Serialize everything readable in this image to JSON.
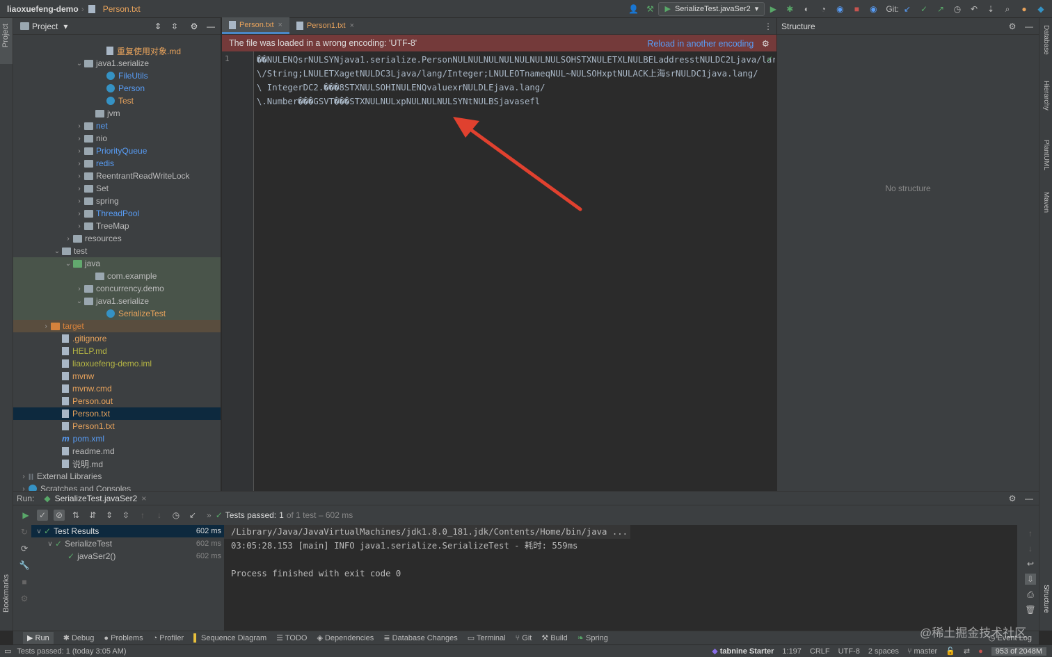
{
  "topbar": {
    "project": "liaoxuefeng-demo",
    "file": "Person.txt",
    "run_config": "SerializeTest.javaSer2",
    "git_label": "Git:"
  },
  "left_strip": {
    "project": "Project",
    "bookmarks": "Bookmarks"
  },
  "right_strip": {
    "database": "Database",
    "hierarchy": "Hierarchy",
    "plantuml": "PlantUML",
    "maven": "Maven",
    "structure": "Structure"
  },
  "project_panel": {
    "title": "Project",
    "items": [
      {
        "label": "重复使用对象.md",
        "indent": 7,
        "kind": "md",
        "color": "#e8a35c",
        "arrow": ""
      },
      {
        "label": "java1.serialize",
        "indent": 5,
        "kind": "folder",
        "color": "#bbbbbb",
        "arrow": "v"
      },
      {
        "label": "FileUtils",
        "indent": 7,
        "kind": "class",
        "color": "#589df6",
        "arrow": ""
      },
      {
        "label": "Person",
        "indent": 7,
        "kind": "class",
        "color": "#589df6",
        "arrow": ""
      },
      {
        "label": "Test",
        "indent": 7,
        "kind": "class",
        "color": "#e8a35c",
        "arrow": ""
      },
      {
        "label": "jvm",
        "indent": 6,
        "kind": "folder",
        "color": "#bbbbbb",
        "arrow": ""
      },
      {
        "label": "net",
        "indent": 5,
        "kind": "folder",
        "color": "#589df6",
        "arrow": ">"
      },
      {
        "label": "nio",
        "indent": 5,
        "kind": "folder",
        "color": "#bbbbbb",
        "arrow": ">"
      },
      {
        "label": "PriorityQueue",
        "indent": 5,
        "kind": "folder",
        "color": "#589df6",
        "arrow": ">"
      },
      {
        "label": "redis",
        "indent": 5,
        "kind": "folder",
        "color": "#589df6",
        "arrow": ">"
      },
      {
        "label": "ReentrantReadWriteLock",
        "indent": 5,
        "kind": "folder",
        "color": "#bbbbbb",
        "arrow": ">"
      },
      {
        "label": "Set",
        "indent": 5,
        "kind": "folder",
        "color": "#bbbbbb",
        "arrow": ">"
      },
      {
        "label": "spring",
        "indent": 5,
        "kind": "folder",
        "color": "#bbbbbb",
        "arrow": ">"
      },
      {
        "label": "ThreadPool",
        "indent": 5,
        "kind": "folder",
        "color": "#589df6",
        "arrow": ">"
      },
      {
        "label": "TreeMap",
        "indent": 5,
        "kind": "folder",
        "color": "#bbbbbb",
        "arrow": ">"
      },
      {
        "label": "resources",
        "indent": 4,
        "kind": "folder",
        "color": "#bbbbbb",
        "arrow": ">"
      },
      {
        "label": "test",
        "indent": 3,
        "kind": "folder",
        "color": "#bbbbbb",
        "arrow": "v"
      },
      {
        "label": "java",
        "indent": 4,
        "kind": "folder-g",
        "color": "#bbbbbb",
        "arrow": "v",
        "bg": "#49544a"
      },
      {
        "label": "com.example",
        "indent": 6,
        "kind": "folder",
        "color": "#bbbbbb",
        "arrow": "",
        "bg": "#49544a"
      },
      {
        "label": "concurrency.demo",
        "indent": 5,
        "kind": "folder",
        "color": "#bbbbbb",
        "arrow": ">",
        "bg": "#49544a"
      },
      {
        "label": "java1.serialize",
        "indent": 5,
        "kind": "folder",
        "color": "#bbbbbb",
        "arrow": "v",
        "bg": "#49544a"
      },
      {
        "label": "SerializeTest",
        "indent": 7,
        "kind": "class",
        "color": "#e8a35c",
        "arrow": "",
        "bg": "#49544a"
      },
      {
        "label": "target",
        "indent": 2,
        "kind": "folder-o",
        "color": "#d6823c",
        "arrow": ">",
        "bg": "#594d3e"
      },
      {
        "label": ".gitignore",
        "indent": 3,
        "kind": "file",
        "color": "#e8a35c",
        "arrow": ""
      },
      {
        "label": "HELP.md",
        "indent": 3,
        "kind": "md",
        "color": "#b5b544",
        "arrow": ""
      },
      {
        "label": "liaoxuefeng-demo.iml",
        "indent": 3,
        "kind": "file",
        "color": "#b5b544",
        "arrow": ""
      },
      {
        "label": "mvnw",
        "indent": 3,
        "kind": "file",
        "color": "#e8a35c",
        "arrow": ""
      },
      {
        "label": "mvnw.cmd",
        "indent": 3,
        "kind": "file",
        "color": "#e8a35c",
        "arrow": ""
      },
      {
        "label": "Person.out",
        "indent": 3,
        "kind": "file",
        "color": "#e8a35c",
        "arrow": ""
      },
      {
        "label": "Person.txt",
        "indent": 3,
        "kind": "file",
        "color": "#e8a35c",
        "arrow": "",
        "bg": "#0d293e"
      },
      {
        "label": "Person1.txt",
        "indent": 3,
        "kind": "file",
        "color": "#e8a35c",
        "arrow": ""
      },
      {
        "label": "pom.xml",
        "indent": 3,
        "kind": "maven",
        "color": "#589df6",
        "arrow": ""
      },
      {
        "label": "readme.md",
        "indent": 3,
        "kind": "md",
        "color": "#bbbbbb",
        "arrow": ""
      },
      {
        "label": "说明.md",
        "indent": 3,
        "kind": "md",
        "color": "#bbbbbb",
        "arrow": ""
      },
      {
        "label": "External Libraries",
        "indent": 0,
        "kind": "lib",
        "color": "#bbbbbb",
        "arrow": ">"
      },
      {
        "label": "Scratches and Consoles",
        "indent": 0,
        "kind": "scratch",
        "color": "#bbbbbb",
        "arrow": ">"
      }
    ]
  },
  "editor": {
    "tabs": [
      {
        "label": "Person.txt",
        "active": true
      },
      {
        "label": "Person1.txt",
        "active": false
      }
    ],
    "warning": "The file was loaded in a wrong encoding: 'UTF-8'",
    "reload_link": "Reload in another encoding",
    "line_number": "1",
    "lines": [
      "��NULENQsrNULSYNjava1.serialize.PersonNULNULNULNULNULNULNULSOHSTXNULETXLNULBELaddresstNULDC2Ljava/lar",
      "\\/String;LNULETXagetNULDC3Ljava/lang/Integer;LNULEOTnameqNUL~NULSOHxptNULACK上海srNULDC1java.lang/",
      "\\ IntegerDC2.���8STXNULSOHINULENQvaluexrNULDLEjava.lang/",
      "\\.Number���GSVT���STXNULNULxpNULNULNULSYNtNULBSjavasefl"
    ]
  },
  "structure": {
    "title": "Structure",
    "empty": "No structure"
  },
  "run": {
    "label": "Run:",
    "tab": "SerializeTest.javaSer2",
    "status_prefix": "Tests passed:",
    "status_count": "1",
    "status_rest": "of 1 test – 602 ms",
    "tree": [
      {
        "label": "Test Results",
        "time": "602 ms"
      },
      {
        "label": "SerializeTest",
        "time": "602 ms"
      },
      {
        "label": "javaSer2()",
        "time": "602 ms"
      }
    ],
    "console": [
      "/Library/Java/JavaVirtualMachines/jdk1.8.0_181.jdk/Contents/Home/bin/java ...",
      "03:05:28.153 [main] INFO java1.serialize.SerializeTest - 耗时: 559ms",
      "",
      "Process finished with exit code 0"
    ]
  },
  "bottom_tools": [
    "Run",
    "Debug",
    "Problems",
    "Profiler",
    "Sequence Diagram",
    "TODO",
    "Dependencies",
    "Database Changes",
    "Terminal",
    "Git",
    "Build",
    "Spring"
  ],
  "event_log": "Event Log",
  "watermark": "@稀土掘金技术社区",
  "statusbar": {
    "message": "Tests passed: 1 (today 3:05 AM)",
    "tabnine": "tabnine Starter",
    "position": "1:197",
    "line_sep": "CRLF",
    "encoding": "UTF-8",
    "indent": "2 spaces",
    "branch": "master",
    "memory": "953 of 2048M"
  },
  "colors": {
    "accent": "#4a88c7",
    "warning_bg": "#743a3a",
    "arrow": "#e0412f",
    "pass": "#59a869"
  }
}
